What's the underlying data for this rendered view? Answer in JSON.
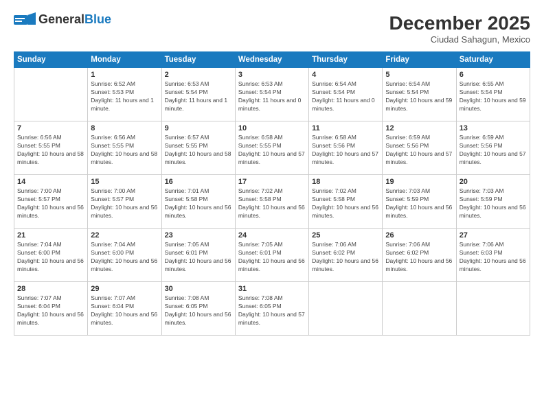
{
  "header": {
    "logo_general": "General",
    "logo_blue": "Blue",
    "month_title": "December 2025",
    "location": "Ciudad Sahagun, Mexico"
  },
  "weekdays": [
    "Sunday",
    "Monday",
    "Tuesday",
    "Wednesday",
    "Thursday",
    "Friday",
    "Saturday"
  ],
  "weeks": [
    [
      {
        "day": "",
        "sunrise": "",
        "sunset": "",
        "daylight": ""
      },
      {
        "day": "1",
        "sunrise": "Sunrise: 6:52 AM",
        "sunset": "Sunset: 5:53 PM",
        "daylight": "Daylight: 11 hours and 1 minute."
      },
      {
        "day": "2",
        "sunrise": "Sunrise: 6:53 AM",
        "sunset": "Sunset: 5:54 PM",
        "daylight": "Daylight: 11 hours and 1 minute."
      },
      {
        "day": "3",
        "sunrise": "Sunrise: 6:53 AM",
        "sunset": "Sunset: 5:54 PM",
        "daylight": "Daylight: 11 hours and 0 minutes."
      },
      {
        "day": "4",
        "sunrise": "Sunrise: 6:54 AM",
        "sunset": "Sunset: 5:54 PM",
        "daylight": "Daylight: 11 hours and 0 minutes."
      },
      {
        "day": "5",
        "sunrise": "Sunrise: 6:54 AM",
        "sunset": "Sunset: 5:54 PM",
        "daylight": "Daylight: 10 hours and 59 minutes."
      },
      {
        "day": "6",
        "sunrise": "Sunrise: 6:55 AM",
        "sunset": "Sunset: 5:54 PM",
        "daylight": "Daylight: 10 hours and 59 minutes."
      }
    ],
    [
      {
        "day": "7",
        "sunrise": "Sunrise: 6:56 AM",
        "sunset": "Sunset: 5:55 PM",
        "daylight": "Daylight: 10 hours and 58 minutes."
      },
      {
        "day": "8",
        "sunrise": "Sunrise: 6:56 AM",
        "sunset": "Sunset: 5:55 PM",
        "daylight": "Daylight: 10 hours and 58 minutes."
      },
      {
        "day": "9",
        "sunrise": "Sunrise: 6:57 AM",
        "sunset": "Sunset: 5:55 PM",
        "daylight": "Daylight: 10 hours and 58 minutes."
      },
      {
        "day": "10",
        "sunrise": "Sunrise: 6:58 AM",
        "sunset": "Sunset: 5:55 PM",
        "daylight": "Daylight: 10 hours and 57 minutes."
      },
      {
        "day": "11",
        "sunrise": "Sunrise: 6:58 AM",
        "sunset": "Sunset: 5:56 PM",
        "daylight": "Daylight: 10 hours and 57 minutes."
      },
      {
        "day": "12",
        "sunrise": "Sunrise: 6:59 AM",
        "sunset": "Sunset: 5:56 PM",
        "daylight": "Daylight: 10 hours and 57 minutes."
      },
      {
        "day": "13",
        "sunrise": "Sunrise: 6:59 AM",
        "sunset": "Sunset: 5:56 PM",
        "daylight": "Daylight: 10 hours and 57 minutes."
      }
    ],
    [
      {
        "day": "14",
        "sunrise": "Sunrise: 7:00 AM",
        "sunset": "Sunset: 5:57 PM",
        "daylight": "Daylight: 10 hours and 56 minutes."
      },
      {
        "day": "15",
        "sunrise": "Sunrise: 7:00 AM",
        "sunset": "Sunset: 5:57 PM",
        "daylight": "Daylight: 10 hours and 56 minutes."
      },
      {
        "day": "16",
        "sunrise": "Sunrise: 7:01 AM",
        "sunset": "Sunset: 5:58 PM",
        "daylight": "Daylight: 10 hours and 56 minutes."
      },
      {
        "day": "17",
        "sunrise": "Sunrise: 7:02 AM",
        "sunset": "Sunset: 5:58 PM",
        "daylight": "Daylight: 10 hours and 56 minutes."
      },
      {
        "day": "18",
        "sunrise": "Sunrise: 7:02 AM",
        "sunset": "Sunset: 5:58 PM",
        "daylight": "Daylight: 10 hours and 56 minutes."
      },
      {
        "day": "19",
        "sunrise": "Sunrise: 7:03 AM",
        "sunset": "Sunset: 5:59 PM",
        "daylight": "Daylight: 10 hours and 56 minutes."
      },
      {
        "day": "20",
        "sunrise": "Sunrise: 7:03 AM",
        "sunset": "Sunset: 5:59 PM",
        "daylight": "Daylight: 10 hours and 56 minutes."
      }
    ],
    [
      {
        "day": "21",
        "sunrise": "Sunrise: 7:04 AM",
        "sunset": "Sunset: 6:00 PM",
        "daylight": "Daylight: 10 hours and 56 minutes."
      },
      {
        "day": "22",
        "sunrise": "Sunrise: 7:04 AM",
        "sunset": "Sunset: 6:00 PM",
        "daylight": "Daylight: 10 hours and 56 minutes."
      },
      {
        "day": "23",
        "sunrise": "Sunrise: 7:05 AM",
        "sunset": "Sunset: 6:01 PM",
        "daylight": "Daylight: 10 hours and 56 minutes."
      },
      {
        "day": "24",
        "sunrise": "Sunrise: 7:05 AM",
        "sunset": "Sunset: 6:01 PM",
        "daylight": "Daylight: 10 hours and 56 minutes."
      },
      {
        "day": "25",
        "sunrise": "Sunrise: 7:06 AM",
        "sunset": "Sunset: 6:02 PM",
        "daylight": "Daylight: 10 hours and 56 minutes."
      },
      {
        "day": "26",
        "sunrise": "Sunrise: 7:06 AM",
        "sunset": "Sunset: 6:02 PM",
        "daylight": "Daylight: 10 hours and 56 minutes."
      },
      {
        "day": "27",
        "sunrise": "Sunrise: 7:06 AM",
        "sunset": "Sunset: 6:03 PM",
        "daylight": "Daylight: 10 hours and 56 minutes."
      }
    ],
    [
      {
        "day": "28",
        "sunrise": "Sunrise: 7:07 AM",
        "sunset": "Sunset: 6:04 PM",
        "daylight": "Daylight: 10 hours and 56 minutes."
      },
      {
        "day": "29",
        "sunrise": "Sunrise: 7:07 AM",
        "sunset": "Sunset: 6:04 PM",
        "daylight": "Daylight: 10 hours and 56 minutes."
      },
      {
        "day": "30",
        "sunrise": "Sunrise: 7:08 AM",
        "sunset": "Sunset: 6:05 PM",
        "daylight": "Daylight: 10 hours and 56 minutes."
      },
      {
        "day": "31",
        "sunrise": "Sunrise: 7:08 AM",
        "sunset": "Sunset: 6:05 PM",
        "daylight": "Daylight: 10 hours and 57 minutes."
      },
      {
        "day": "",
        "sunrise": "",
        "sunset": "",
        "daylight": ""
      },
      {
        "day": "",
        "sunrise": "",
        "sunset": "",
        "daylight": ""
      },
      {
        "day": "",
        "sunrise": "",
        "sunset": "",
        "daylight": ""
      }
    ]
  ]
}
